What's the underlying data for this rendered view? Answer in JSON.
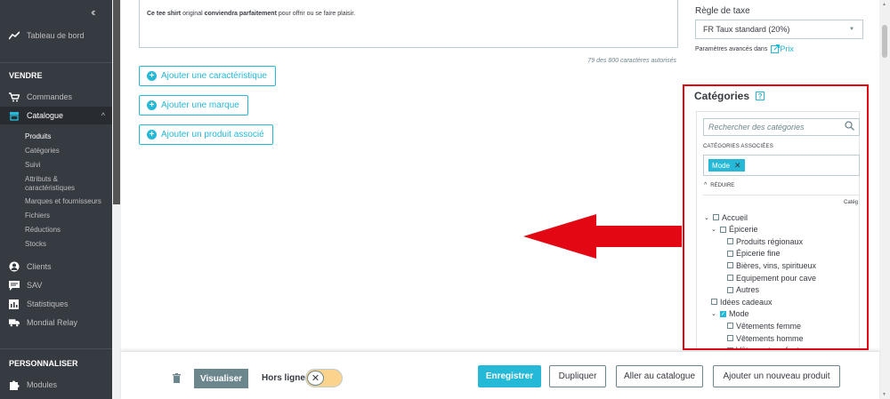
{
  "sidebar": {
    "dashboard": "Tableau de bord",
    "section_sell": "VENDRE",
    "orders": "Commandes",
    "catalog": "Catalogue",
    "catalog_sub": [
      "Produits",
      "Catégories",
      "Suivi",
      "Attributs &",
      "caractéristiques",
      "Marques et fournisseurs",
      "Fichiers",
      "Réductions",
      "Stocks"
    ],
    "customers": "Clients",
    "sav": "SAV",
    "stats": "Statistiques",
    "mondial": "Mondial Relay",
    "section_customize": "PERSONNALISER",
    "modules": "Modules"
  },
  "description": {
    "part1": "Ce tee shirt",
    "part2": " original ",
    "part3": "conviendra parfaitement",
    "part4": " pour offrir ou se faire plaisir.",
    "char_count": "79 des 800 caractères autorisés"
  },
  "actions": {
    "add_feature": "Ajouter une caractéristique",
    "add_brand": "Ajouter une marque",
    "add_related": "Ajouter un produit associé"
  },
  "tax": {
    "label": "Règle de taxe",
    "value": "FR Taux standard (20%)",
    "advanced": "Paramètres avancés dans",
    "price_link": "Prix"
  },
  "categories": {
    "title": "Catégories",
    "help": "?",
    "search_placeholder": "Rechercher des catégories",
    "associated_label": "CATÉGORIES ASSOCIÉES",
    "tag": "Mode",
    "reduce": "RÉDUIRE",
    "col_head": "Catég",
    "tree": [
      {
        "label": "Accueil",
        "level": 0,
        "toggle": "⌄",
        "checked": false
      },
      {
        "label": "Épicerie",
        "level": 1,
        "toggle": "⌄",
        "checked": false
      },
      {
        "label": "Produits régionaux",
        "level": 2,
        "toggle": "",
        "checked": false
      },
      {
        "label": "Épicerie fine",
        "level": 2,
        "toggle": "",
        "checked": false
      },
      {
        "label": "Bières, vins, spiritueux",
        "level": 2,
        "toggle": "",
        "checked": false
      },
      {
        "label": "Equipement pour cave",
        "level": 2,
        "toggle": "",
        "checked": false
      },
      {
        "label": "Autres",
        "level": 2,
        "toggle": "",
        "checked": false
      },
      {
        "label": "Idées cadeaux",
        "level": 1,
        "toggle": "",
        "checked": false
      },
      {
        "label": "Mode",
        "level": 1,
        "toggle": "⌄",
        "checked": true
      },
      {
        "label": "Vêtements femme",
        "level": 2,
        "toggle": "",
        "checked": false
      },
      {
        "label": "Vêtements homme",
        "level": 2,
        "toggle": "",
        "checked": false
      },
      {
        "label": "Vêtements enfant",
        "level": 2,
        "toggle": "",
        "checked": false
      }
    ]
  },
  "footer": {
    "preview": "Visualiser",
    "offline": "Hors ligne",
    "save": "Enregistrer",
    "duplicate": "Dupliquer",
    "to_catalog": "Aller au catalogue",
    "new_product": "Ajouter un nouveau produit"
  },
  "colors": {
    "accent": "#25b9d7",
    "highlight": "#e30613",
    "sidebar": "#363a41"
  }
}
